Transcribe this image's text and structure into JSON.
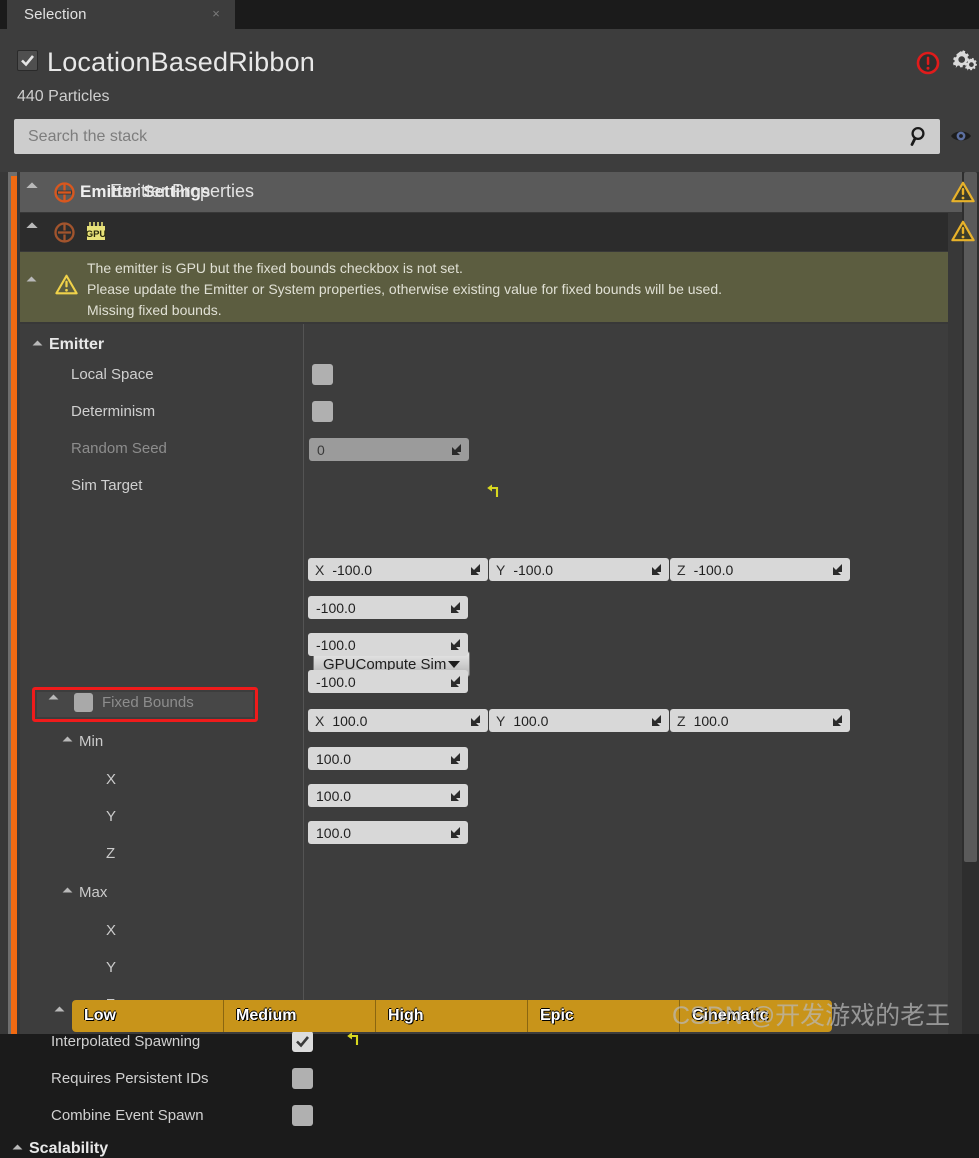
{
  "tab": {
    "label": "Selection",
    "close": "×"
  },
  "header": {
    "title": "LocationBasedRibbon",
    "enabled_checkbox": true,
    "particles": "440 Particles",
    "error_icon": "error-circle-icon",
    "settings_icon": "gear-icon"
  },
  "search": {
    "placeholder": "Search the stack",
    "value": "",
    "icon": "magnifier-icon",
    "eye_icon": "eye-icon"
  },
  "stack": {
    "emitter_settings": {
      "label": "Emitter Settings",
      "icon": "emitter-icon",
      "warning_icon": "warning-triangle-icon"
    },
    "emitter_properties": {
      "label": "Emitter Properties",
      "icon": "emitter-icon",
      "badge": "GPU",
      "warning_icon": "warning-triangle-icon"
    },
    "warning": {
      "line1": "The emitter is GPU but the fixed bounds checkbox is not set.",
      "line2": "Please update the Emitter or System properties, otherwise existing value for fixed bounds will be used.",
      "line3": "Missing fixed bounds.",
      "icon": "warning-triangle-icon"
    },
    "emitter_group": {
      "label": "Emitter"
    },
    "properties": [
      {
        "label": "Local Space",
        "type": "checkbox",
        "checked": false,
        "disabled": false
      },
      {
        "label": "Determinism",
        "type": "checkbox",
        "checked": false,
        "disabled": false
      },
      {
        "label": "Random Seed",
        "type": "number",
        "value": "0",
        "disabled": true
      },
      {
        "label": "Sim Target",
        "type": "combo",
        "value": "GPUCompute Sim",
        "reset": true
      }
    ],
    "fixed_bounds": {
      "label": "Fixed Bounds",
      "checked": false,
      "highlighted": true,
      "highlight_color": "#ef1b1b"
    },
    "min": {
      "label": "Min",
      "vector": [
        {
          "axis": "X",
          "value": "-100.0"
        },
        {
          "axis": "Y",
          "value": "-100.0"
        },
        {
          "axis": "Z",
          "value": "-100.0"
        }
      ],
      "components": [
        {
          "label": "X",
          "value": "-100.0"
        },
        {
          "label": "Y",
          "value": "-100.0"
        },
        {
          "label": "Z",
          "value": "-100.0"
        }
      ]
    },
    "max": {
      "label": "Max",
      "vector": [
        {
          "axis": "X",
          "value": "100.0"
        },
        {
          "axis": "Y",
          "value": "100.0"
        },
        {
          "axis": "Z",
          "value": "100.0"
        }
      ],
      "components": [
        {
          "label": "X",
          "value": "100.0"
        },
        {
          "label": "Y",
          "value": "100.0"
        },
        {
          "label": "Z",
          "value": "100.0"
        }
      ]
    },
    "properties_tail": [
      {
        "label": "Interpolated Spawning",
        "type": "checkbox",
        "checked": true,
        "reset": true
      },
      {
        "label": "Requires Persistent IDs",
        "type": "checkbox",
        "checked": false
      },
      {
        "label": "Combine Event Spawn",
        "type": "checkbox",
        "checked": false
      }
    ],
    "scalability": {
      "label": "Scalability",
      "quality_levels": [
        "Low",
        "Medium",
        "High",
        "Epic",
        "Cinematic"
      ],
      "accent_color": "#c8941a"
    }
  },
  "watermark": "CSDN @开发游戏的老王",
  "colors": {
    "accent_bar": "#f06a12",
    "warning_bg": "#5c5d40",
    "warning_icon": "#e8b22a",
    "error": "#e01b1b"
  }
}
